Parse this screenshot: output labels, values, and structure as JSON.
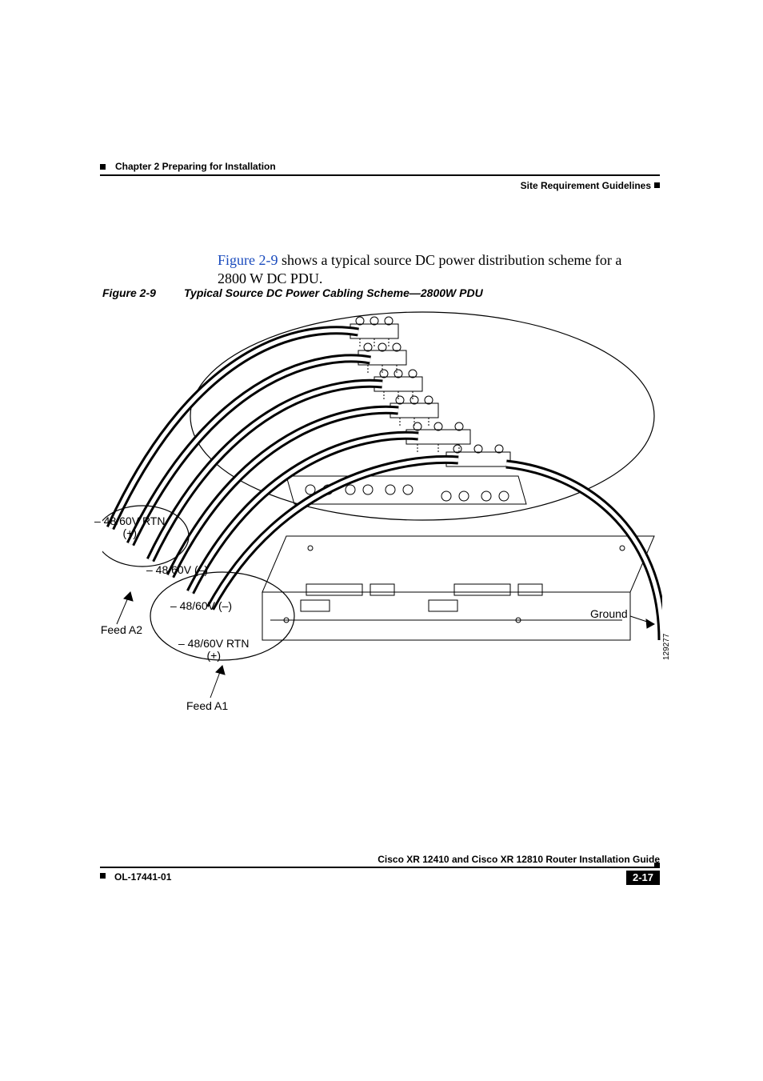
{
  "header": {
    "chapter": "Chapter 2      Preparing for Installation",
    "section": "Site Requirement Guidelines"
  },
  "body": {
    "xref": "Figure 2-9",
    "para_rest": " shows a typical source DC power distribution scheme for a 2800 W DC PDU."
  },
  "figure": {
    "label": "Figure 2-9",
    "title": "Typical Source DC Power Cabling Scheme—2800W PDU",
    "labels": {
      "rtn1": "– 48/60V RTN\n(+)",
      "neg1": "– 48/60V (–)",
      "neg2": "– 48/60V (–)",
      "rtn2": "– 48/60V RTN\n(+)",
      "feedA2": "Feed A2",
      "feedA1": "Feed A1",
      "ground": "Ground",
      "imageid": "129277"
    }
  },
  "footer": {
    "guide": "Cisco XR 12410 and Cisco XR 12810 Router Installation Guide",
    "docnum": "OL-17441-01",
    "page": "2-17"
  }
}
